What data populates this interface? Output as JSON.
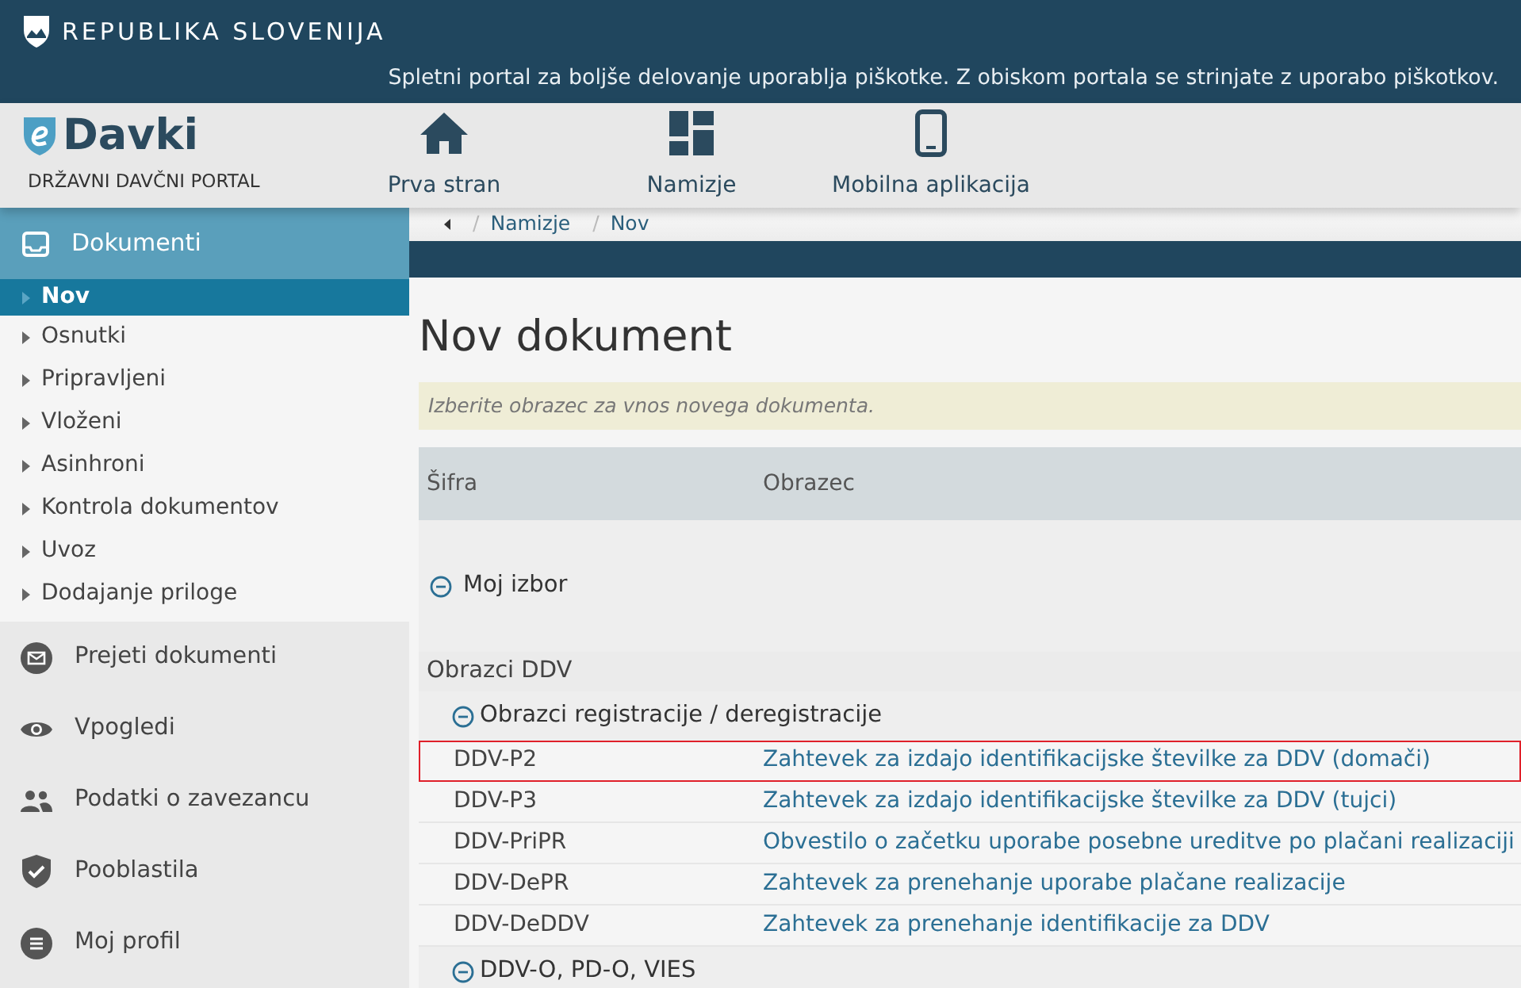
{
  "banner": {
    "title": "REPUBLIKA SLOVENIJA",
    "cookie_notice": "Spletni portal za boljše delovanje uporablja piškotke. Z obiskom portala se strinjate z uporabo piškotkov."
  },
  "header": {
    "logo_text": "Davki",
    "subtitle": "DRŽAVNI DAVČNI PORTAL",
    "nav": [
      {
        "kind": "home",
        "label": "Prva stran"
      },
      {
        "kind": "dashboard",
        "label": "Namizje"
      },
      {
        "kind": "phone",
        "label": "Mobilna aplikacija"
      }
    ]
  },
  "sidebar": {
    "section": {
      "label": "Dokumenti",
      "expanded": true
    },
    "items": [
      {
        "label": "Nov",
        "selected": true
      },
      {
        "label": "Osnutki",
        "selected": false
      },
      {
        "label": "Pripravljeni",
        "selected": false
      },
      {
        "label": "Vloženi",
        "selected": false
      },
      {
        "label": "Asinhroni",
        "selected": false
      },
      {
        "label": "Kontrola dokumentov",
        "selected": false
      },
      {
        "label": "Uvoz",
        "selected": false
      },
      {
        "label": "Dodajanje priloge",
        "selected": false
      }
    ],
    "menu": [
      {
        "kind": "mail",
        "label": "Prejeti dokumenti"
      },
      {
        "kind": "eye",
        "label": "Vpogledi"
      },
      {
        "kind": "people",
        "label": "Podatki o zavezancu"
      },
      {
        "kind": "shield",
        "label": "Pooblastila"
      },
      {
        "kind": "list",
        "label": "Moj profil"
      }
    ]
  },
  "breadcrumb": [
    {
      "separator": "/",
      "label": "Namizje"
    },
    {
      "separator": "/",
      "label": "Nov"
    }
  ],
  "page": {
    "title": "Nov dokument",
    "hint": "Izberite obrazec za vnos novega dokumenta.",
    "table": {
      "columns": [
        "Šifra",
        "Obrazec"
      ],
      "rows": [
        {
          "kind": "group",
          "label": "Moj izbor",
          "expanded": true
        },
        {
          "kind": "section",
          "label": "Obrazci DDV"
        },
        {
          "kind": "subgroup",
          "label": "Obrazci registracije / deregistracije",
          "expanded": true
        },
        {
          "kind": "form",
          "code": "DDV-P2",
          "name": "Zahtevek za izdajo identifikacijske številke za DDV (domači)",
          "selected": true
        },
        {
          "kind": "form",
          "code": "DDV-P3",
          "name": "Zahtevek za izdajo identifikacijske številke za DDV (tujci)",
          "selected": false
        },
        {
          "kind": "form",
          "code": "DDV-PriPR",
          "name": "Obvestilo o začetku uporabe posebne ureditve po plačani realizaciji",
          "selected": false
        },
        {
          "kind": "form",
          "code": "DDV-DePR",
          "name": "Zahtevek za prenehanje uporabe plačane realizacije",
          "selected": false
        },
        {
          "kind": "form",
          "code": "DDV-DeDDV",
          "name": "Zahtevek za prenehanje identifikacije za DDV",
          "selected": false
        },
        {
          "kind": "subgroup",
          "label": "DDV-O, PD-O, VIES",
          "expanded": true
        }
      ]
    }
  }
}
